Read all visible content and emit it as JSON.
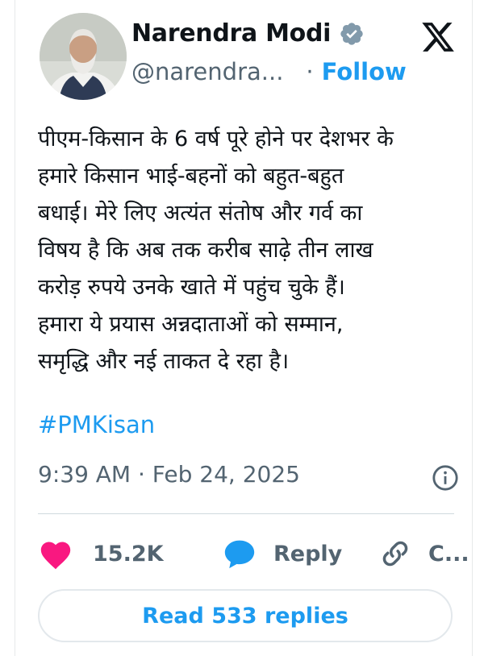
{
  "author": {
    "name": "Narendra Modi",
    "handle": "@narendra...",
    "separator": "·",
    "follow_label": "Follow"
  },
  "tweet": {
    "text": "पीएम-किसान के 6 वर्ष पूरे होने पर देशभर के\nहमारे किसान भाई-बहनों को बहुत-बहुत\nबधाई। मेरे लिए अत्यंत संतोष और गर्व का\nविषय है कि अब तक करीब साढ़े तीन लाख\nकरोड़ रुपये उनके खाते में पहुंच चुके हैं।\nहमारा ये प्रयास अन्नदाताओं को सम्मान,\nसमृद्धि और नई ताकत दे रहा है।",
    "hashtag": "#PMKisan",
    "timestamp": "9:39 AM · Feb 24, 2025"
  },
  "actions": {
    "likes": "15.2K",
    "reply_label": "Reply",
    "copy_label": "C..."
  },
  "read_replies_label": "Read 533 replies",
  "colors": {
    "accent": "#1d9bf0",
    "like": "#f91880",
    "muted": "#536471"
  },
  "icons": [
    "verified-badge-icon",
    "x-logo-icon",
    "info-icon",
    "heart-icon",
    "reply-bubble-icon",
    "link-icon"
  ]
}
